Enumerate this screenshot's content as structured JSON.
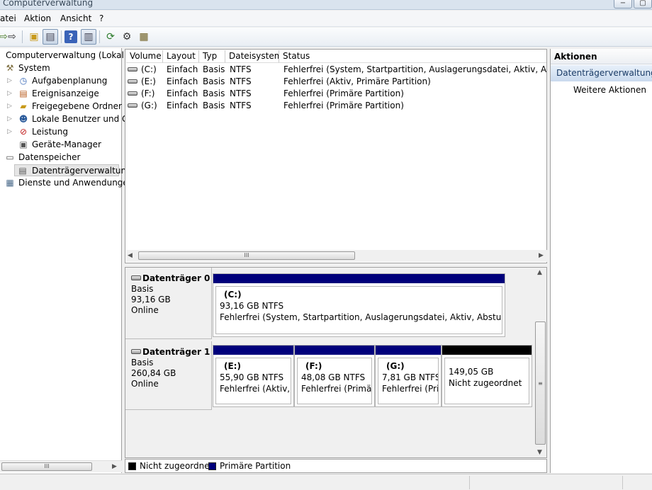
{
  "window": {
    "title": "Computerverwaltung"
  },
  "menu": [
    "atei",
    "Aktion",
    "Ansicht",
    "?"
  ],
  "toolbar": {
    "icons": [
      "back-arrow-icon",
      "forward-arrow-icon",
      "up-folder-icon",
      "show-tree-icon",
      "help-icon",
      "properties-icon",
      "refresh-icon",
      "settings-icon",
      "disk-tool-icon"
    ]
  },
  "tree": {
    "root": "Computerverwaltung (Lokal)",
    "system": "System",
    "items": [
      {
        "label": "Aufgabenplanung"
      },
      {
        "label": "Ereignisanzeige"
      },
      {
        "label": "Freigegebene Ordner"
      },
      {
        "label": "Lokale Benutzer und Gr"
      },
      {
        "label": "Leistung"
      },
      {
        "label": "Geräte-Manager"
      }
    ],
    "storage": "Datenspeicher",
    "selected": "Datenträgerverwaltung",
    "services": "Dienste und Anwendungen"
  },
  "volumes": {
    "columns": [
      "Volume",
      "Layout",
      "Typ",
      "Dateisystem",
      "Status"
    ],
    "rows": [
      {
        "volume": "(C:)",
        "layout": "Einfach",
        "type": "Basis",
        "fs": "NTFS",
        "status": "Fehlerfrei (System, Startpartition, Auslagerungsdatei, Aktiv, Absturzabb"
      },
      {
        "volume": "(E:)",
        "layout": "Einfach",
        "type": "Basis",
        "fs": "NTFS",
        "status": "Fehlerfrei (Aktiv, Primäre Partition)"
      },
      {
        "volume": "(F:)",
        "layout": "Einfach",
        "type": "Basis",
        "fs": "NTFS",
        "status": "Fehlerfrei (Primäre Partition)"
      },
      {
        "volume": "(G:)",
        "layout": "Einfach",
        "type": "Basis",
        "fs": "NTFS",
        "status": "Fehlerfrei (Primäre Partition)"
      }
    ]
  },
  "disks": [
    {
      "name": "Datenträger 0",
      "kind": "Basis",
      "size": "93,16 GB",
      "state": "Online",
      "partitions": [
        {
          "label": "(C:)",
          "size": "93,16 GB NTFS",
          "status": "Fehlerfrei (System, Startpartition, Auslagerungsdatei, Aktiv, Absturzabbild, P",
          "color": "#00007b"
        }
      ]
    },
    {
      "name": "Datenträger 1",
      "kind": "Basis",
      "size": "260,84 GB",
      "state": "Online",
      "partitions": [
        {
          "label": "(E:)",
          "size": "55,90 GB NTFS",
          "status": "Fehlerfrei (Aktiv, Pr",
          "color": "#00007b"
        },
        {
          "label": "(F:)",
          "size": "48,08 GB NTFS",
          "status": "Fehlerfrei (Primäre",
          "color": "#00007b"
        },
        {
          "label": "(G:)",
          "size": "7,81 GB NTFS",
          "status": "Fehlerfrei (Prim",
          "color": "#00007b"
        },
        {
          "label": "",
          "size": "149,05 GB",
          "status": "Nicht zugeordnet",
          "color": "#000000"
        }
      ]
    }
  ],
  "legend": [
    {
      "label": "Nicht zugeordnet",
      "color": "#000000"
    },
    {
      "label": "Primäre Partition",
      "color": "#00007b"
    }
  ],
  "actions": {
    "title": "Aktionen",
    "group": "Datenträgerverwaltung",
    "item": "Weitere Aktionen"
  }
}
